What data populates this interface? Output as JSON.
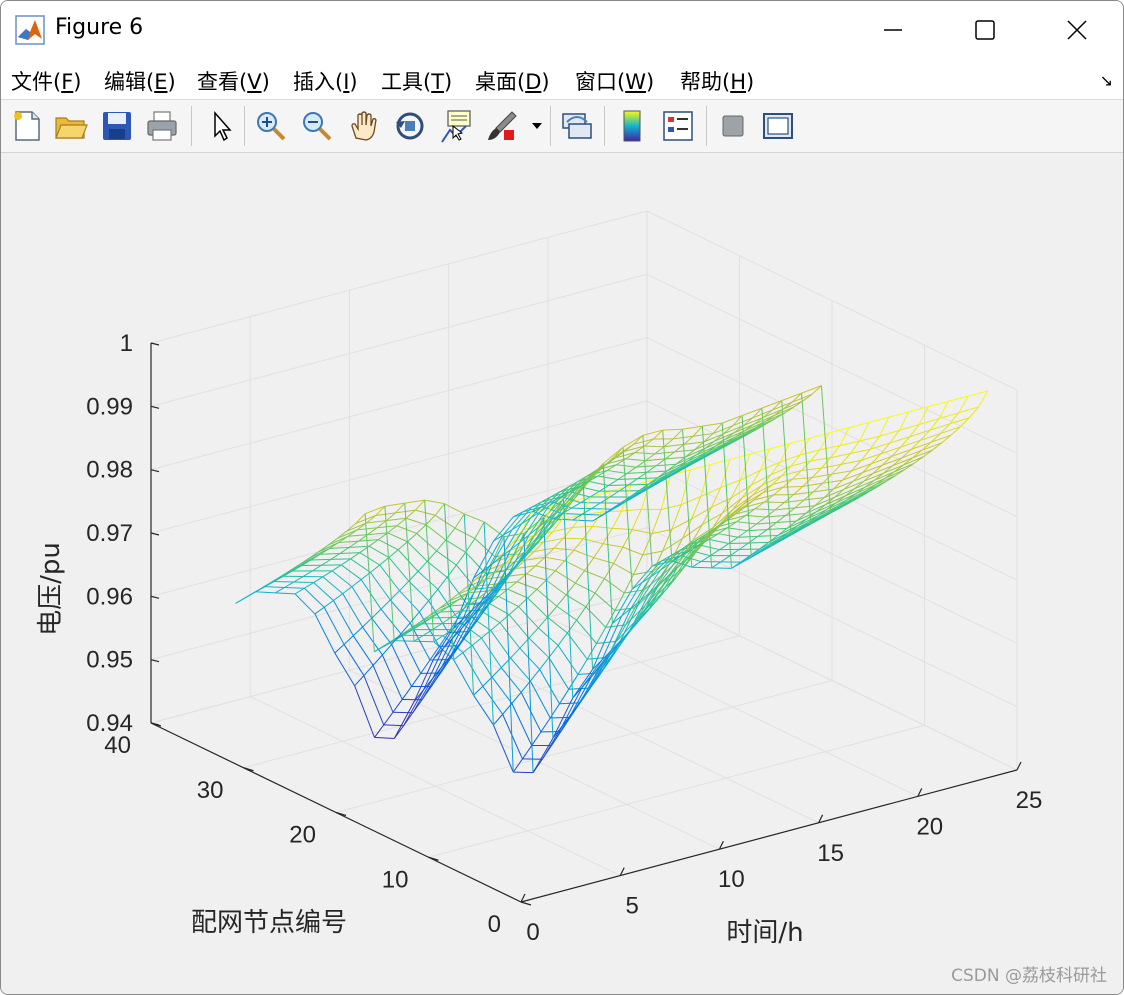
{
  "window": {
    "title": "Figure 6"
  },
  "menu": {
    "items": [
      {
        "text": "文件(",
        "key": "F",
        "end": ")"
      },
      {
        "text": "编辑(",
        "key": "E",
        "end": ")"
      },
      {
        "text": "查看(",
        "key": "V",
        "end": ")"
      },
      {
        "text": "插入(",
        "key": "I",
        "end": ")"
      },
      {
        "text": "工具(",
        "key": "T",
        "end": ")"
      },
      {
        "text": "桌面(",
        "key": "D",
        "end": ")"
      },
      {
        "text": "窗口(",
        "key": "W",
        "end": ")"
      },
      {
        "text": "帮助(",
        "key": "H",
        "end": ")"
      }
    ],
    "dock_icon": "undock-arrow-icon"
  },
  "toolbar": {
    "icons": [
      "new-figure-icon",
      "open-file-icon",
      "save-icon",
      "print-icon",
      "pointer-icon",
      "zoom-in-icon",
      "zoom-out-icon",
      "pan-hand-icon",
      "rotate-3d-icon",
      "data-cursor-icon",
      "brush-icon",
      "brush-dropdown-icon",
      "link-plot-icon",
      "colorbar-icon",
      "legend-icon",
      "hide-plot-tools-icon",
      "show-plot-tools-icon"
    ]
  },
  "chart_data": {
    "type": "surface-mesh",
    "xlabel": "时间/h",
    "ylabel": "配网节点编号",
    "zlabel": "电压/pu",
    "xticks": [
      0,
      5,
      10,
      15,
      20,
      25
    ],
    "yticks": [
      0,
      10,
      20,
      30,
      40
    ],
    "zticks": [
      0.94,
      0.95,
      0.96,
      0.97,
      0.98,
      0.99,
      1
    ],
    "xlim": [
      0,
      25
    ],
    "ylim": [
      0,
      40
    ],
    "zlim": [
      0.94,
      1
    ],
    "grid": true,
    "colormap": "parula",
    "colors": {
      "low": "#3e26a8",
      "mid": "#13b4cd",
      "high": "#f9fb0e"
    },
    "x_hours": [
      1,
      2,
      3,
      4,
      5,
      6,
      7,
      8,
      9,
      10,
      11,
      12,
      13,
      14,
      15,
      16,
      17,
      18,
      19,
      20,
      21,
      22,
      23,
      24
    ],
    "nodes": [
      1,
      33
    ],
    "voltage_profile": {
      "node_33_min_vs_hour": [
        0.963,
        0.964,
        0.963,
        0.962,
        0.958,
        0.951,
        0.945,
        0.936,
        0.935,
        0.94,
        0.946,
        0.95,
        0.957,
        0.962,
        0.965,
        0.965,
        0.963,
        0.962,
        0.961,
        0.962,
        0.963,
        0.964,
        0.965,
        0.966
      ],
      "node_1_max": 1.0
    }
  },
  "watermark": "CSDN @荔枝科研社"
}
